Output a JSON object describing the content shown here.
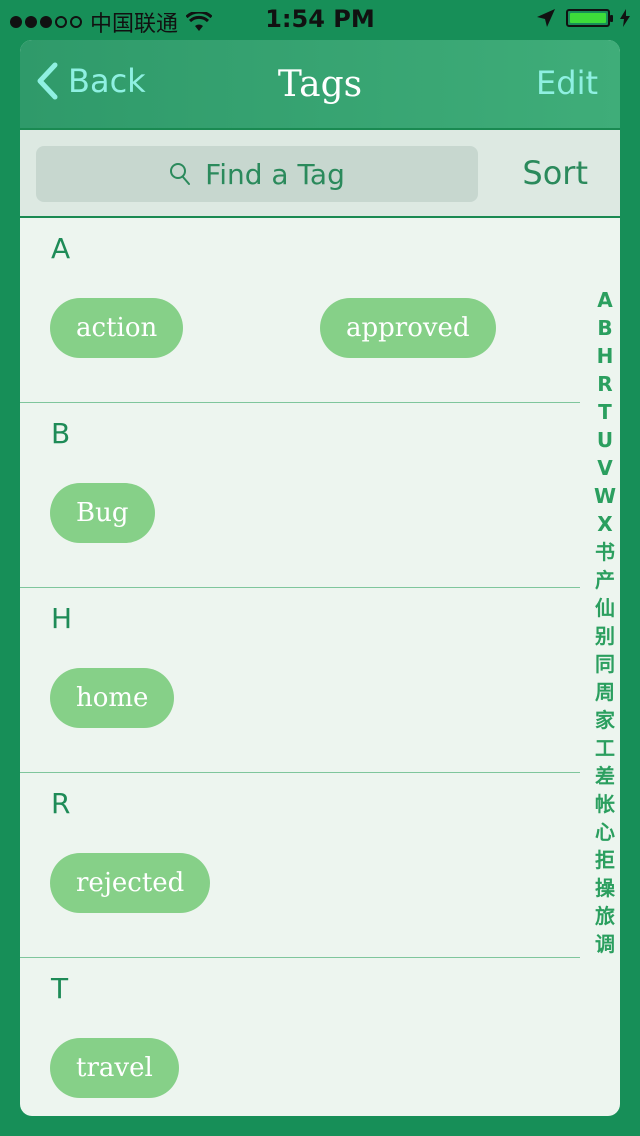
{
  "status_bar": {
    "carrier": "中国联通",
    "time": "1:54 PM"
  },
  "nav": {
    "back_label": "Back",
    "title": "Tags",
    "edit_label": "Edit"
  },
  "search": {
    "placeholder": "Find a Tag",
    "sort_label": "Sort"
  },
  "sections": [
    {
      "header": "A",
      "tags": [
        "action",
        "approved"
      ]
    },
    {
      "header": "B",
      "tags": [
        "Bug"
      ]
    },
    {
      "header": "H",
      "tags": [
        "home"
      ]
    },
    {
      "header": "R",
      "tags": [
        "rejected"
      ]
    },
    {
      "header": "T",
      "tags": [
        "travel"
      ]
    }
  ],
  "index": [
    "A",
    "B",
    "H",
    "R",
    "T",
    "U",
    "V",
    "W",
    "X",
    "书",
    "产",
    "仙",
    "别",
    "同",
    "周",
    "家",
    "工",
    "差",
    "帐",
    "心",
    "拒",
    "操",
    "旅",
    "调"
  ]
}
